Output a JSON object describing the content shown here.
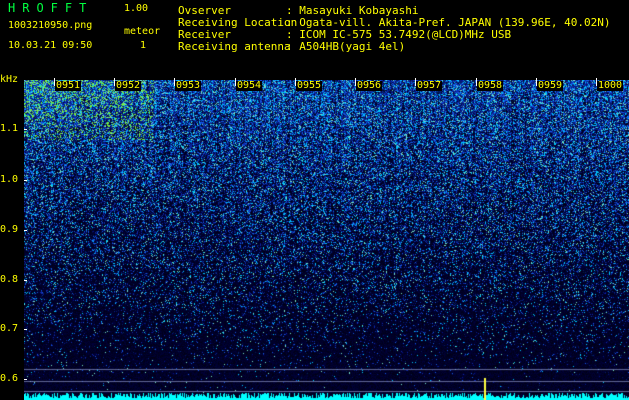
{
  "header": {
    "app_title": "HROFFT",
    "app_version": "1.00",
    "filename": "1003210950.png",
    "datetime": "10.03.21 09:50",
    "meteor_label": "meteor",
    "meteor_count": "1",
    "info": [
      {
        "key": "Ovserver",
        "value": ": Masayuki Kobayashi"
      },
      {
        "key": "Receiving Location",
        "value": ": Ogata-vill. Akita-Pref. JAPAN (139.96E, 40.02N)"
      },
      {
        "key": "Receiver",
        "value": ": ICOM IC-575 53.7492(@LCD)MHz USB"
      },
      {
        "key": "Receiving antenna",
        "value": ": A504HB(yagi 4el)"
      }
    ]
  },
  "axis": {
    "unit": "kHz",
    "y_ticks": [
      "1.1",
      "1.0",
      "0.9",
      "0.8",
      "0.7",
      "0.6"
    ],
    "x_ticks": [
      "0951",
      "0952",
      "0953",
      "0954",
      "0955",
      "0956",
      "0957",
      "0958",
      "0959",
      "1000"
    ]
  },
  "colors": {
    "background": "#000000",
    "header_text": "#ffff00",
    "title": "#00ff40",
    "noise_low": "#0a1060",
    "noise_high": "#00ffff"
  }
}
